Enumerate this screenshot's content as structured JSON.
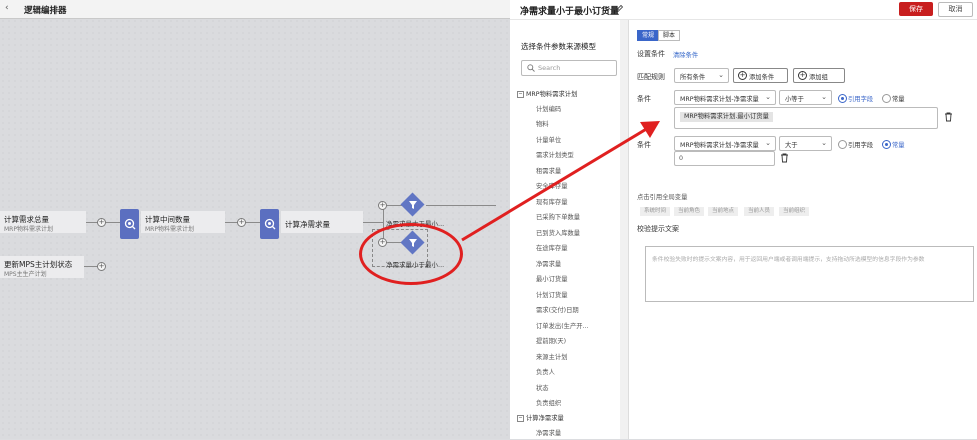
{
  "canvas": {
    "title": "逻辑编排器",
    "back_icon": "chevron-left-icon",
    "nodes": [
      {
        "title": "计算需求总量",
        "subtitle": "MRP物料需求计划"
      },
      {
        "title": "计算中间数量",
        "subtitle": "MRP物料需求计划"
      },
      {
        "title": "计算净需求量",
        "subtitle": ""
      },
      {
        "title": "更新MPS主计划状态",
        "subtitle": "MPS主生产计划"
      }
    ],
    "decisions": [
      {
        "label": "净需求量大于最小..."
      },
      {
        "label": "净需求量小于最小..."
      }
    ]
  },
  "panel": {
    "title": "净需求量小于最小订货量",
    "save_label": "保存",
    "cancel_label": "取消",
    "tabs": [
      {
        "label": "常规"
      },
      {
        "label": "脚本"
      }
    ],
    "source": {
      "title": "选择条件参数来源模型",
      "search_placeholder": "Search",
      "groups": [
        {
          "label": "MRP物料需求计划",
          "items": [
            "计划编码",
            "物料",
            "计量单位",
            "需求计划类型",
            "租需求量",
            "安全库存量",
            "现有库存量",
            "已采购下单数量",
            "已到货入库数量",
            "在途库存量",
            "净需求量",
            "最小订货量",
            "计划订货量",
            "需求(交付)日期",
            "订单发出(生产开...",
            "提前期(天)",
            "来源主计划",
            "负责人",
            "状态",
            "负责组织"
          ]
        },
        {
          "label": "计算净需求量",
          "items": [
            "净需求量"
          ]
        }
      ]
    },
    "set_condition_label": "设置条件",
    "clear_condition_link": "清除条件",
    "match_rule_label": "匹配规则",
    "match_rule_value": "所有条件",
    "add_condition_label": "添加条件",
    "add_group_label": "添加组",
    "conditions": [
      {
        "label": "条件",
        "field": "MRP物料需求计划-净需求量",
        "operator": "小等于",
        "mode_ref_label": "引用字段",
        "mode_const_label": "常量",
        "selected": "ref",
        "value": "MRP物料需求计划.最小订货量"
      },
      {
        "label": "条件",
        "field": "MRP物料需求计划-净需求量",
        "operator": "大于",
        "mode_ref_label": "引用字段",
        "mode_const_label": "常量",
        "selected": "const",
        "value": "0"
      }
    ],
    "global_var_label": "点击引用全局变量",
    "global_vars": [
      "系统时间",
      "当前角色",
      "当前地点",
      "当前人员",
      "当前组织"
    ],
    "validation_label": "校验提示文案",
    "validation_placeholder": "条件校验失败时的提示文案内容，用于返回用户端或者调用端提示，支持拖动所选模型的信息字段作为参数"
  }
}
